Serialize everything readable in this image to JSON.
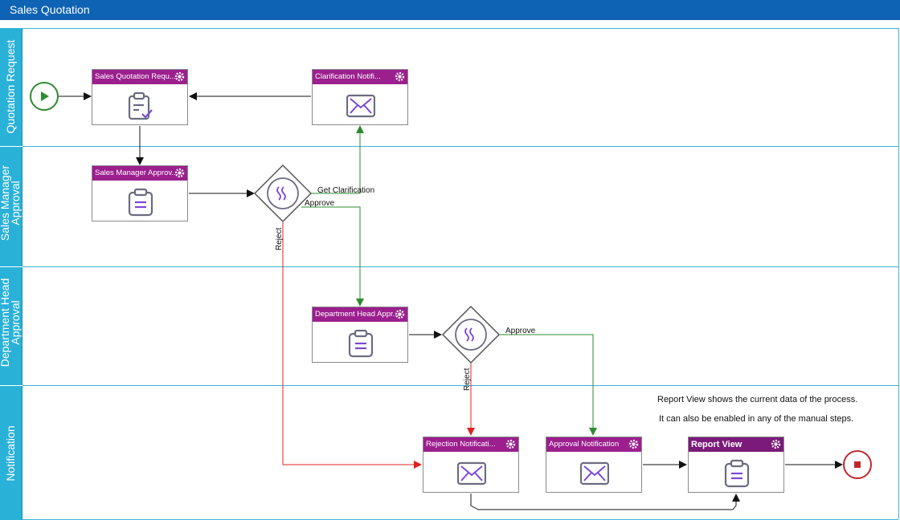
{
  "window": {
    "title": "Sales Quotation"
  },
  "lanes": [
    {
      "label": "Quotation Request"
    },
    {
      "label": "Sales Manager Approval"
    },
    {
      "label": "Department Head Approval"
    },
    {
      "label": "Notification"
    }
  ],
  "tasks": {
    "sales_quotation_request": "Sales Quotation Requ...",
    "clarification_notification": "Clarification Notifi...",
    "sales_manager_approval": "Sales Manager Approv...",
    "department_head_approval": "Department Head Appr...",
    "rejection_notification": "Rejection Notificati...",
    "approval_notification": "Approval Notification",
    "report_view": "Report View"
  },
  "edges": {
    "get_clarification": "Get Clarification",
    "approve_1": "Approve",
    "reject_1": "Reject",
    "approve_2": "Approve",
    "reject_2": "Reject"
  },
  "notes": {
    "line1": "Report View shows the current data of the process.",
    "line2": "It can also be enabled in any of the manual steps."
  },
  "colors": {
    "title_bar": "#0e63b4",
    "lane_label": "#2ab1d8",
    "task_header": "#9c1f8e",
    "approve_line": "#2e8b2e",
    "reject_line": "#e02020",
    "start": "#2e8b2e",
    "end": "#c0282d",
    "icon": "#6b6b80"
  }
}
